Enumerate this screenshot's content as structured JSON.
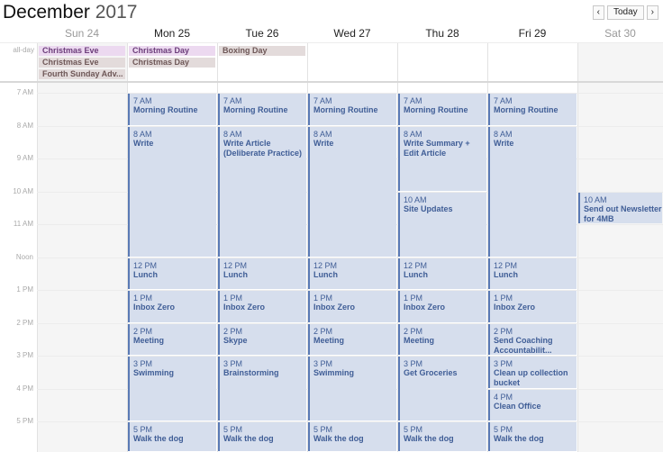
{
  "header": {
    "month": "December",
    "year": "2017",
    "today_label": "Today",
    "prev_icon": "‹",
    "next_icon": "›"
  },
  "days": [
    {
      "label": "Sun 24",
      "weekend": true
    },
    {
      "label": "Mon 25",
      "weekend": false
    },
    {
      "label": "Tue 26",
      "weekend": false
    },
    {
      "label": "Wed 27",
      "weekend": false
    },
    {
      "label": "Thu 28",
      "weekend": false
    },
    {
      "label": "Fri 29",
      "weekend": false
    },
    {
      "label": "Sat 30",
      "weekend": true
    }
  ],
  "allday_label": "all-day",
  "allday_events": [
    {
      "day": 0,
      "row": 0,
      "span": 1,
      "name": "Christmas Eve",
      "color": "purple"
    },
    {
      "day": 0,
      "row": 1,
      "span": 1,
      "name": "Christmas Eve",
      "color": "gray"
    },
    {
      "day": 0,
      "row": 2,
      "span": 1,
      "name": "Fourth Sunday Adv...",
      "color": "gray"
    },
    {
      "day": 1,
      "row": 0,
      "span": 1,
      "name": "Christmas Day",
      "color": "purple"
    },
    {
      "day": 1,
      "row": 1,
      "span": 1,
      "name": "Christmas Day",
      "color": "gray"
    },
    {
      "day": 2,
      "row": 0,
      "span": 1,
      "name": "Boxing Day",
      "color": "gray"
    }
  ],
  "hours": [
    "7 AM",
    "8 AM",
    "9 AM",
    "10 AM",
    "11 AM",
    "Noon",
    "1 PM",
    "2 PM",
    "3 PM",
    "4 PM",
    "5 PM"
  ],
  "events": [
    {
      "day": 1,
      "start": 7,
      "end": 8,
      "time": "7 AM",
      "name": "Morning Routine"
    },
    {
      "day": 2,
      "start": 7,
      "end": 8,
      "time": "7 AM",
      "name": "Morning Routine"
    },
    {
      "day": 3,
      "start": 7,
      "end": 8,
      "time": "7 AM",
      "name": "Morning Routine"
    },
    {
      "day": 4,
      "start": 7,
      "end": 8,
      "time": "7 AM",
      "name": "Morning Routine"
    },
    {
      "day": 5,
      "start": 7,
      "end": 8,
      "time": "7 AM",
      "name": "Morning Routine"
    },
    {
      "day": 1,
      "start": 8,
      "end": 12,
      "time": "8 AM",
      "name": "Write"
    },
    {
      "day": 2,
      "start": 8,
      "end": 12,
      "time": "8 AM",
      "name": "Write Article (Deliberate Practice)"
    },
    {
      "day": 3,
      "start": 8,
      "end": 12,
      "time": "8 AM",
      "name": "Write"
    },
    {
      "day": 4,
      "start": 8,
      "end": 10,
      "time": "8 AM",
      "name": "Write Summary + Edit Article"
    },
    {
      "day": 4,
      "start": 10,
      "end": 12,
      "time": "10 AM",
      "name": "Site Updates"
    },
    {
      "day": 5,
      "start": 8,
      "end": 12,
      "time": "8 AM",
      "name": "Write"
    },
    {
      "day": 6,
      "start": 10,
      "end": 11,
      "time": "10 AM",
      "name": "Send out Newsletter for 4MB"
    },
    {
      "day": 1,
      "start": 12,
      "end": 13,
      "time": "12 PM",
      "name": "Lunch"
    },
    {
      "day": 2,
      "start": 12,
      "end": 13,
      "time": "12 PM",
      "name": "Lunch"
    },
    {
      "day": 3,
      "start": 12,
      "end": 13,
      "time": "12 PM",
      "name": "Lunch"
    },
    {
      "day": 4,
      "start": 12,
      "end": 13,
      "time": "12 PM",
      "name": "Lunch"
    },
    {
      "day": 5,
      "start": 12,
      "end": 13,
      "time": "12 PM",
      "name": "Lunch"
    },
    {
      "day": 1,
      "start": 13,
      "end": 14,
      "time": "1 PM",
      "name": "Inbox Zero"
    },
    {
      "day": 2,
      "start": 13,
      "end": 14,
      "time": "1 PM",
      "name": "Inbox Zero"
    },
    {
      "day": 3,
      "start": 13,
      "end": 14,
      "time": "1 PM",
      "name": "Inbox Zero"
    },
    {
      "day": 4,
      "start": 13,
      "end": 14,
      "time": "1 PM",
      "name": "Inbox Zero"
    },
    {
      "day": 5,
      "start": 13,
      "end": 14,
      "time": "1 PM",
      "name": "Inbox Zero"
    },
    {
      "day": 1,
      "start": 14,
      "end": 15,
      "time": "2 PM",
      "name": "Meeting"
    },
    {
      "day": 2,
      "start": 14,
      "end": 15,
      "time": "2 PM",
      "name": "Skype"
    },
    {
      "day": 3,
      "start": 14,
      "end": 15,
      "time": "2 PM",
      "name": "Meeting"
    },
    {
      "day": 4,
      "start": 14,
      "end": 15,
      "time": "2 PM",
      "name": "Meeting"
    },
    {
      "day": 5,
      "start": 14,
      "end": 15,
      "time": "2 PM",
      "name": "Send Coaching Accountabilit..."
    },
    {
      "day": 1,
      "start": 15,
      "end": 17,
      "time": "3 PM",
      "name": "Swimming"
    },
    {
      "day": 2,
      "start": 15,
      "end": 17,
      "time": "3 PM",
      "name": "Brainstorming"
    },
    {
      "day": 3,
      "start": 15,
      "end": 17,
      "time": "3 PM",
      "name": "Swimming"
    },
    {
      "day": 4,
      "start": 15,
      "end": 17,
      "time": "3 PM",
      "name": "Get Groceries"
    },
    {
      "day": 5,
      "start": 15,
      "end": 16,
      "time": "3 PM",
      "name": "Clean up collection bucket"
    },
    {
      "day": 5,
      "start": 16,
      "end": 17,
      "time": "4 PM",
      "name": "Clean Office"
    },
    {
      "day": 1,
      "start": 17,
      "end": 18,
      "time": "5 PM",
      "name": "Walk the dog"
    },
    {
      "day": 2,
      "start": 17,
      "end": 18,
      "time": "5 PM",
      "name": "Walk the dog"
    },
    {
      "day": 3,
      "start": 17,
      "end": 18,
      "time": "5 PM",
      "name": "Walk the dog"
    },
    {
      "day": 4,
      "start": 17,
      "end": 18,
      "time": "5 PM",
      "name": "Walk the dog"
    },
    {
      "day": 5,
      "start": 17,
      "end": 18,
      "time": "5 PM",
      "name": "Walk the dog"
    }
  ]
}
